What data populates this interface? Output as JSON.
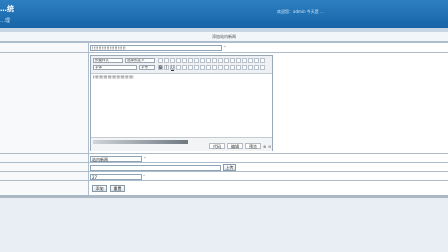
{
  "header": {
    "title": "…统",
    "subtitle": "…理",
    "status": "欢迎您：admin 今天是 …"
  },
  "form": {
    "title": "添加站内新闻",
    "title_field": {
      "value": "!!!!!!!!!!!!!!!!!!!!!",
      "req": "*"
    },
    "editor": {
      "select_paragraph": "段落样式",
      "select_fontfamily": "字体",
      "select_fontsize": "字号",
      "select_format": "预置样式",
      "select_style": "选择预定义",
      "content": "!!!!!!!!!!!!!!!!!!!!!!!!!!!!!!!",
      "mode_buttons": [
        "代码",
        "编辑",
        "预览"
      ],
      "zoom_labels": [
        "⊕",
        "⊖"
      ]
    },
    "author_field": {
      "value": "站内新闻",
      "req": "*"
    },
    "file_field": {
      "value": "",
      "upload_label": "上传"
    },
    "order_field": {
      "value": "27",
      "req": "*"
    },
    "buttons": {
      "submit": "添加",
      "reset": "重置"
    }
  }
}
